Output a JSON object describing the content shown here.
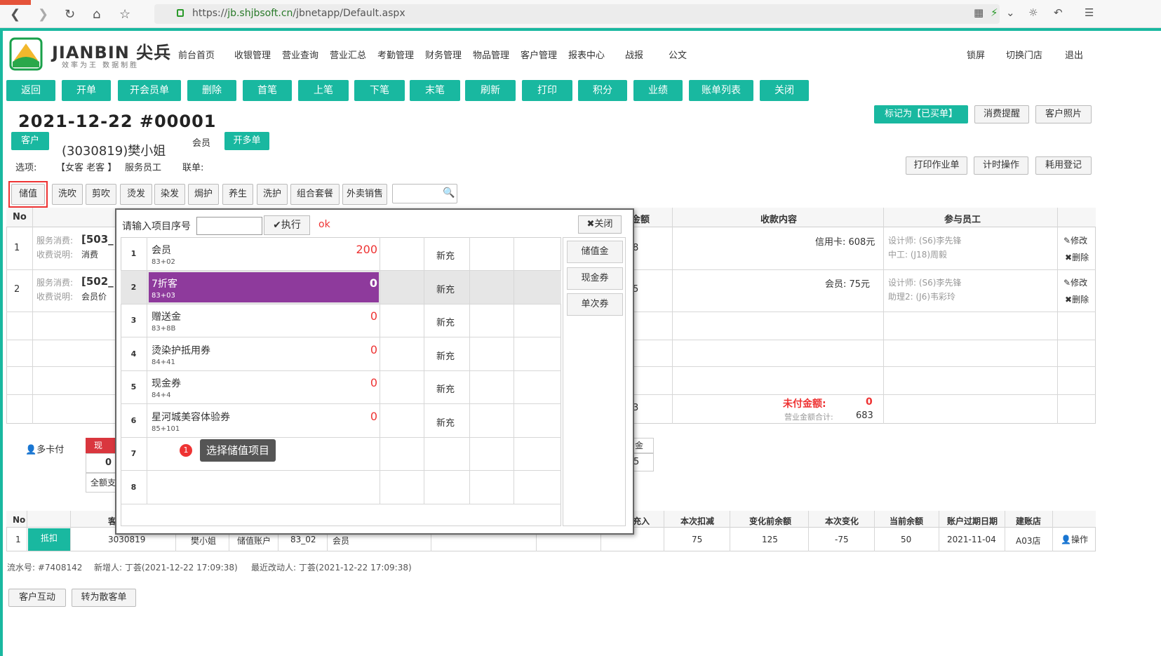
{
  "browser": {
    "url_prefix": "https://",
    "url_host": "jb.shjbsoft.cn",
    "url_path": "/jbnetapp/Default.aspx"
  },
  "brand": {
    "name": "JIANBIN 尖兵",
    "slogan": "效率为王 数据制胜"
  },
  "nav": [
    "前台首页",
    "收银管理",
    "营业查询",
    "营业汇总",
    "考勤管理",
    "财务管理",
    "物品管理",
    "客户管理",
    "报表中心",
    "战报",
    "公文"
  ],
  "nav_right": [
    "锁屏",
    "切换门店",
    "退出"
  ],
  "toolbar": [
    "返回",
    "开单",
    "开会员单",
    "删除",
    "首笔",
    "上笔",
    "下笔",
    "末笔",
    "刷新",
    "打印",
    "积分",
    "业绩",
    "账单列表",
    "关闭"
  ],
  "title": "2021-12-22  #00001",
  "title_buttons": [
    "标记为【已买单】",
    "消费提醒",
    "客户照片"
  ],
  "customer": {
    "btn": "客户",
    "name": "(3030819)樊小姐",
    "level": "会员",
    "multi": "开多单"
  },
  "options": {
    "label": "选项:",
    "value": "【女客 老客 】",
    "staff": "服务员工",
    "link": "联单:"
  },
  "action_buttons": [
    "打印作业单",
    "计时操作",
    "耗用登记"
  ],
  "categories": [
    "储值",
    "洗吹",
    "剪吹",
    "烫发",
    "染发",
    "焗护",
    "养生",
    "洗护",
    "组合套餐",
    "外卖销售"
  ],
  "table_headers": {
    "no": "No",
    "amount_suffix": "金额",
    "content": "收款内容",
    "staff": "参与员工"
  },
  "rows": [
    {
      "no": "1",
      "svc": "服务消费:",
      "svc_val": "[503_",
      "note": "收费说明:",
      "note_val": "消费",
      "amt": "8",
      "pay": "信用卡:  608元",
      "staff1": "设计师:   (S6)李先锋",
      "staff2": "中工:   (J18)周毅"
    },
    {
      "no": "2",
      "svc": "服务消费:",
      "svc_val": "[502_",
      "note": "收费说明:",
      "note_val": "会员价",
      "amt": "5",
      "pay": "会员:   75元",
      "staff1": "设计师:   (S6)李先锋",
      "staff2": "助理2:   (J6)韦彩玲"
    }
  ],
  "row_actions": [
    "修改",
    "删除"
  ],
  "summary": {
    "unpaid_label": "未付金额:",
    "unpaid": "0",
    "total_label": "营业金额合计:",
    "total": "683",
    "amt": "3"
  },
  "multi_card": "多卡付",
  "cash_partial": {
    "label": "现",
    "value": "0",
    "note": "全额支"
  },
  "right_partial": {
    "label": "金",
    "value": "5"
  },
  "modal": {
    "label": "请输入项目序号",
    "exec": "执行",
    "ok": "ok",
    "close": "关闭",
    "items": [
      {
        "no": "1",
        "name": "会员",
        "code": "83+02",
        "val": "200",
        "type": "新充"
      },
      {
        "no": "2",
        "name": "7折客",
        "code": "83+03",
        "val": "0",
        "type": "新充"
      },
      {
        "no": "3",
        "name": "赠送金",
        "code": "83+8B",
        "val": "0",
        "type": "新充"
      },
      {
        "no": "4",
        "name": "烫染护抵用券",
        "code": "84+41",
        "val": "0",
        "type": "新充"
      },
      {
        "no": "5",
        "name": "现金券",
        "code": "84+4",
        "val": "0",
        "type": "新充"
      },
      {
        "no": "6",
        "name": "星河城美容体验券",
        "code": "85+101",
        "val": "0",
        "type": "新充"
      },
      {
        "no": "7",
        "name": "",
        "code": "",
        "val": "",
        "type": ""
      },
      {
        "no": "8",
        "name": "",
        "code": "",
        "val": "",
        "type": ""
      }
    ],
    "side": [
      "储值金",
      "现金券",
      "单次券"
    ]
  },
  "tooltip": {
    "num": "1",
    "text": "选择储值项目"
  },
  "bottom_table": {
    "headers": [
      "No",
      "客",
      "充入",
      "本次扣减",
      "变化前余额",
      "本次变化",
      "当前余额",
      "账户过期日期",
      "建账店"
    ],
    "row": {
      "no": "1",
      "btn": "抵扣",
      "id": "3030819",
      "name": "樊小姐",
      "acct": "储值账户",
      "code": "83_02",
      "type": "会员",
      "deduct": "75",
      "before": "125",
      "change": "-75",
      "current": "50",
      "expire": "2021-11-04",
      "store": "A03店",
      "op": "操作"
    }
  },
  "footer": {
    "serial": "流水号: #7408142",
    "creator": "新增人: 丁荟(2021-12-22 17:09:38)",
    "modifier": "最近改动人: 丁荟(2021-12-22 17:09:38)"
  },
  "footer_buttons": [
    "客户互动",
    "转为散客单"
  ],
  "colors": {
    "teal": "#19b8a0",
    "purple": "#8e3a9c",
    "red": "#e33"
  }
}
